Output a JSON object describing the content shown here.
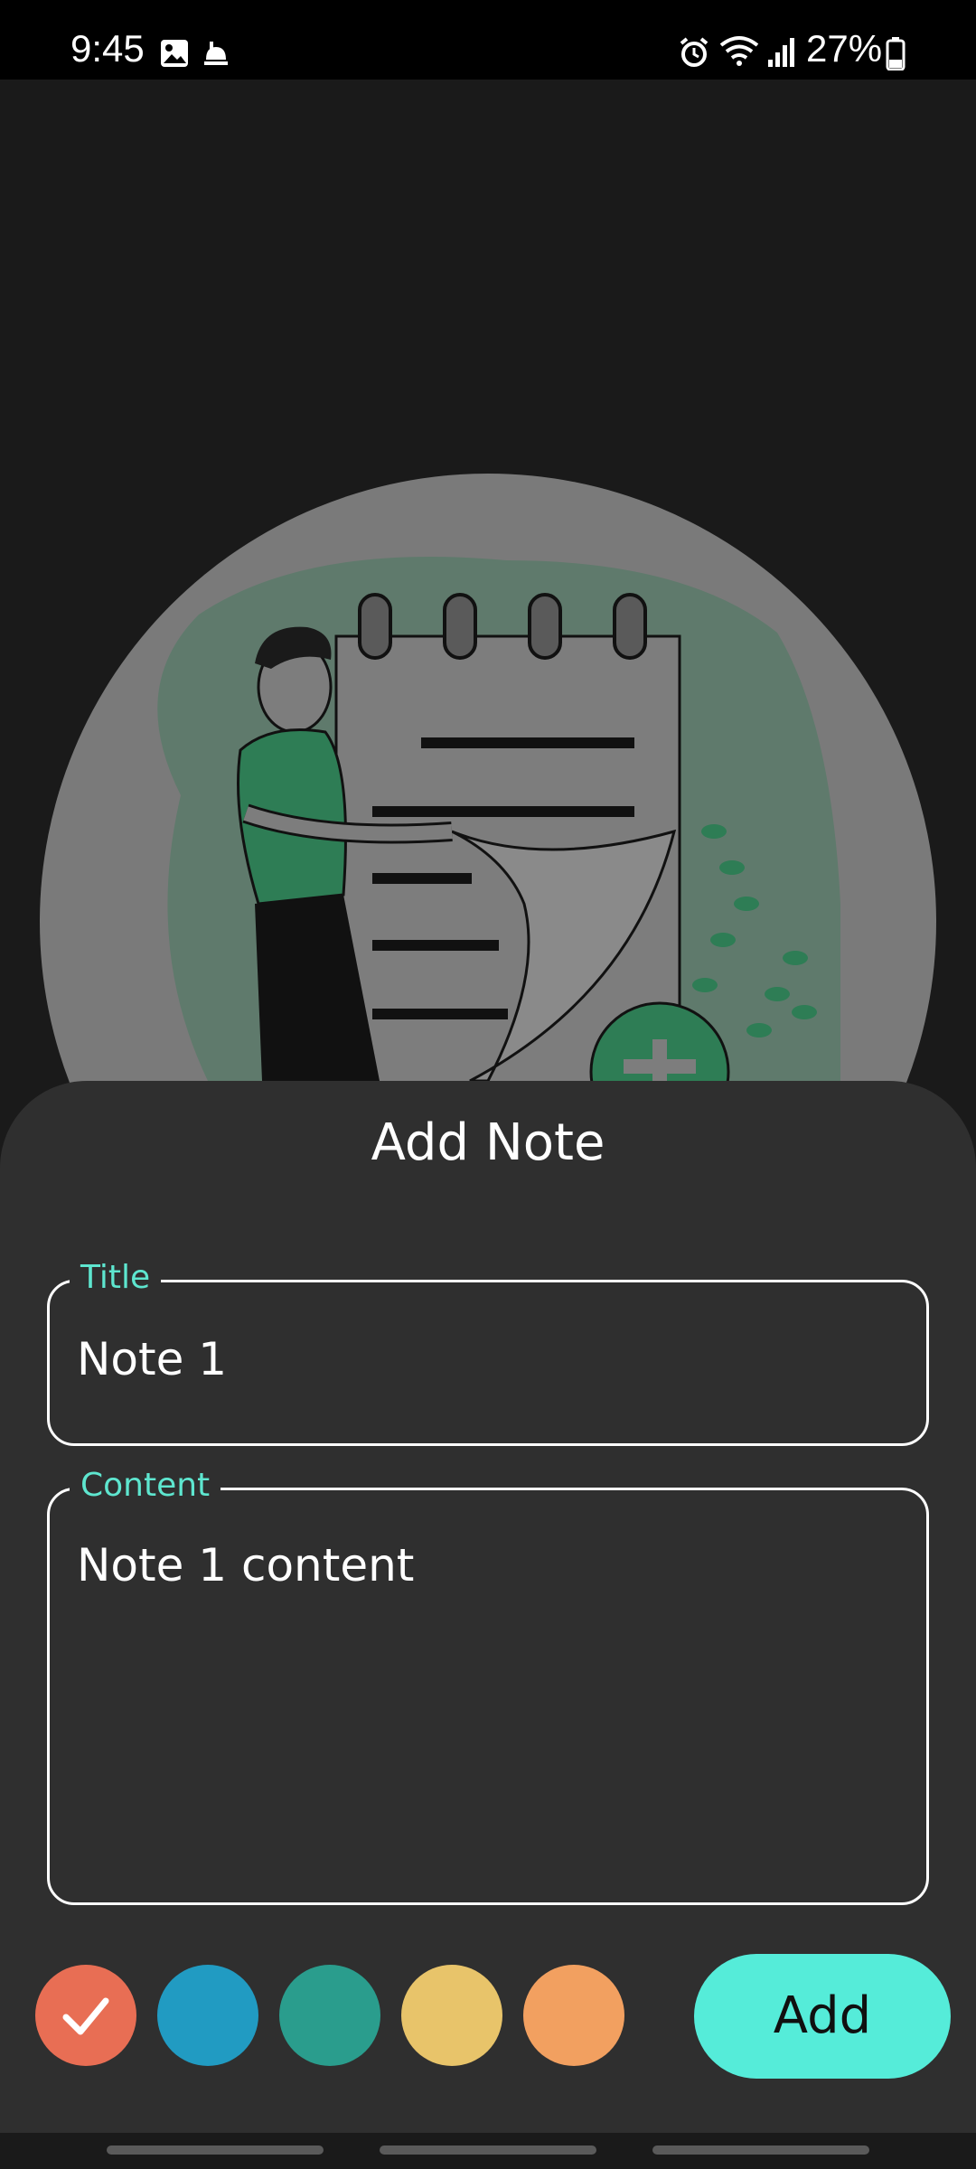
{
  "status_bar": {
    "time": "9:45",
    "battery": "27%",
    "icons": [
      "image-icon",
      "notification-icon",
      "alarm-icon",
      "wifi-icon",
      "signal-icon",
      "battery-icon"
    ]
  },
  "sheet": {
    "title": "Add Note"
  },
  "title_field": {
    "label": "Title",
    "value": "Note 1"
  },
  "content_field": {
    "label": "Content",
    "value": "Note 1 content"
  },
  "colors": {
    "swatches": [
      {
        "name": "coral",
        "hex": "#e86e54",
        "selected": true
      },
      {
        "name": "blue",
        "hex": "#219bc2",
        "selected": false
      },
      {
        "name": "teal",
        "hex": "#2a9d8d",
        "selected": false
      },
      {
        "name": "yellow",
        "hex": "#e8c46a",
        "selected": false
      },
      {
        "name": "orange",
        "hex": "#f2a060",
        "selected": false
      }
    ],
    "accent": "#55ecd9",
    "label_accent": "#5ee6cf"
  },
  "actions": {
    "add_label": "Add"
  }
}
